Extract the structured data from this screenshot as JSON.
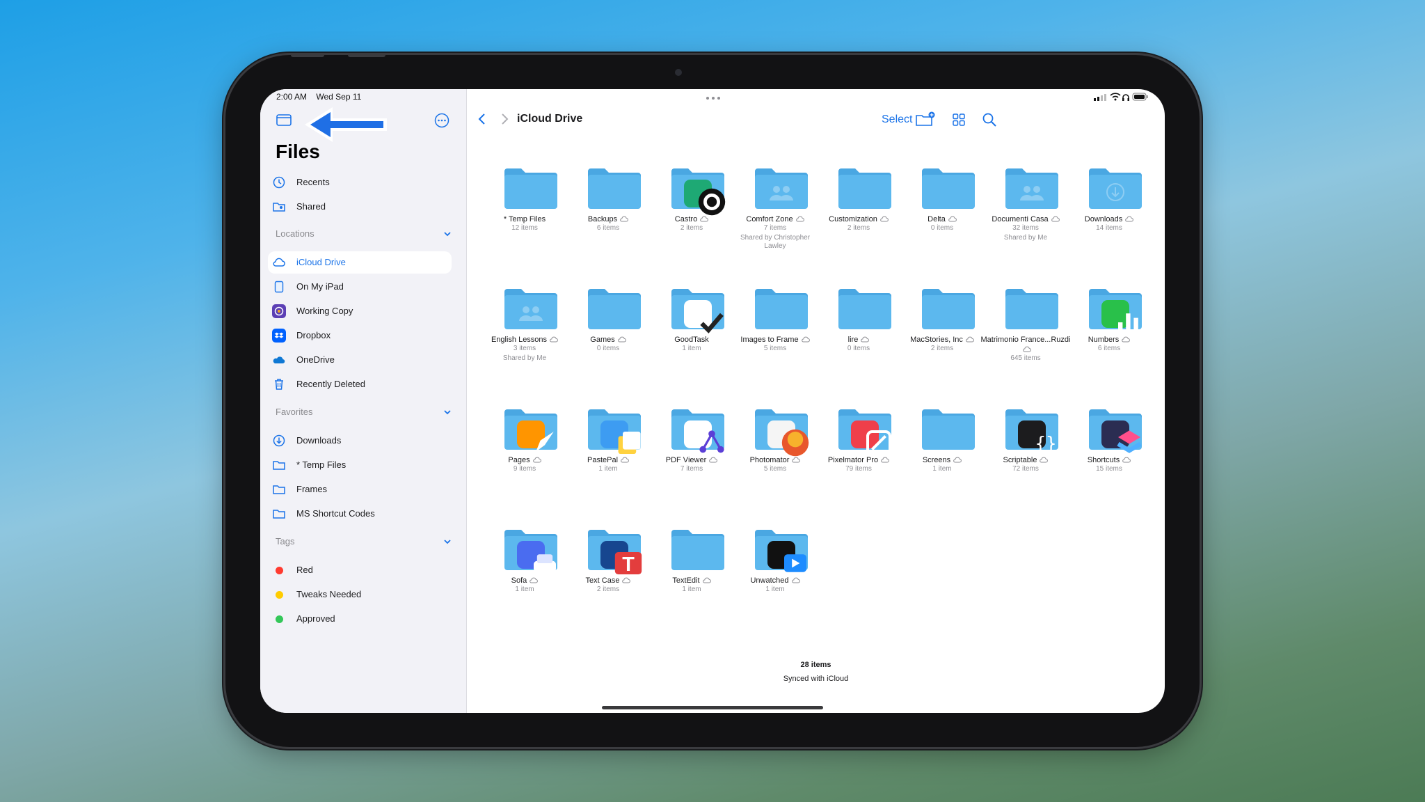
{
  "status": {
    "time": "2:00 AM",
    "date": "Wed Sep 11"
  },
  "sidebar": {
    "title": "Files",
    "top_items": [
      {
        "label": "Recents",
        "icon": "clock-icon"
      },
      {
        "label": "Shared",
        "icon": "shared-folder-icon"
      }
    ],
    "locations": {
      "heading": "Locations",
      "items": [
        {
          "label": "iCloud Drive",
          "icon": "cloud-icon",
          "active": true
        },
        {
          "label": "On My iPad",
          "icon": "ipad-icon"
        },
        {
          "label": "Working Copy",
          "icon": "working-copy-icon"
        },
        {
          "label": "Dropbox",
          "icon": "dropbox-icon"
        },
        {
          "label": "OneDrive",
          "icon": "onedrive-icon"
        },
        {
          "label": "Recently Deleted",
          "icon": "trash-icon"
        }
      ]
    },
    "favorites": {
      "heading": "Favorites",
      "items": [
        {
          "label": "Downloads",
          "icon": "download-icon"
        },
        {
          "label": "* Temp Files",
          "icon": "folder-icon"
        },
        {
          "label": "Frames",
          "icon": "folder-icon"
        },
        {
          "label": "MS Shortcut Codes",
          "icon": "folder-icon"
        }
      ]
    },
    "tags": {
      "heading": "Tags",
      "items": [
        {
          "label": "Red",
          "color": "#ff3b30"
        },
        {
          "label": "Tweaks Needed",
          "color": "#ffcc00"
        },
        {
          "label": "Approved",
          "color": "#34c759"
        }
      ]
    }
  },
  "toolbar": {
    "title": "iCloud Drive",
    "select_label": "Select"
  },
  "folders": [
    {
      "name": "* Temp Files",
      "meta": "12 items"
    },
    {
      "name": "Backups",
      "meta": "6 items",
      "cloud": true
    },
    {
      "name": "Castro",
      "meta": "2 items",
      "cloud": true,
      "app": "castro"
    },
    {
      "name": "Comfort Zone",
      "meta": "7 items",
      "cloud": true,
      "shared": true,
      "note": "Shared by Christopher Lawley"
    },
    {
      "name": "Customization",
      "meta": "2 items",
      "cloud": true
    },
    {
      "name": "Delta",
      "meta": "0 items",
      "cloud": true
    },
    {
      "name": "Documenti Casa",
      "meta": "32 items",
      "cloud": true,
      "shared": true,
      "note": "Shared by Me"
    },
    {
      "name": "Downloads",
      "meta": "14 items",
      "cloud": true,
      "download": true
    },
    {
      "name": "English Lessons",
      "meta": "3 items",
      "cloud": true,
      "shared": true,
      "note": "Shared by Me"
    },
    {
      "name": "Games",
      "meta": "0 items",
      "cloud": true
    },
    {
      "name": "GoodTask",
      "meta": "1 item",
      "app": "goodtask"
    },
    {
      "name": "Images to Frame",
      "meta": "5 items",
      "cloud": true
    },
    {
      "name": "lire",
      "meta": "0 items",
      "cloud": true
    },
    {
      "name": "MacStories, Inc",
      "meta": "2 items",
      "cloud": true
    },
    {
      "name": "Matrimonio France...Ruzdi",
      "meta": "645 items",
      "cloud": true
    },
    {
      "name": "Numbers",
      "meta": "6 items",
      "cloud": true,
      "app": "numbers"
    },
    {
      "name": "Pages",
      "meta": "9 items",
      "cloud": true,
      "app": "pages"
    },
    {
      "name": "PastePal",
      "meta": "1 item",
      "cloud": true,
      "app": "pastepal"
    },
    {
      "name": "PDF Viewer",
      "meta": "7 items",
      "cloud": true,
      "app": "pdfviewer"
    },
    {
      "name": "Photomator",
      "meta": "5 items",
      "cloud": true,
      "app": "photomator"
    },
    {
      "name": "Pixelmator Pro",
      "meta": "79 items",
      "cloud": true,
      "app": "pixelmator"
    },
    {
      "name": "Screens",
      "meta": "1 item",
      "cloud": true
    },
    {
      "name": "Scriptable",
      "meta": "72 items",
      "cloud": true,
      "app": "scriptable"
    },
    {
      "name": "Shortcuts",
      "meta": "15 items",
      "cloud": true,
      "app": "shortcuts"
    },
    {
      "name": "Sofa",
      "meta": "1 item",
      "cloud": true,
      "app": "sofa"
    },
    {
      "name": "Text Case",
      "meta": "2 items",
      "cloud": true,
      "app": "textcase"
    },
    {
      "name": "TextEdit",
      "meta": "1 item",
      "cloud": true
    },
    {
      "name": "Unwatched",
      "meta": "1 item",
      "cloud": true,
      "app": "unwatched"
    }
  ],
  "footer": {
    "count": "28 items",
    "sync": "Synced with iCloud"
  },
  "colors": {
    "accent": "#1a73e8",
    "folder": "#5cb8ee",
    "folder_tab": "#4aa7e2"
  }
}
